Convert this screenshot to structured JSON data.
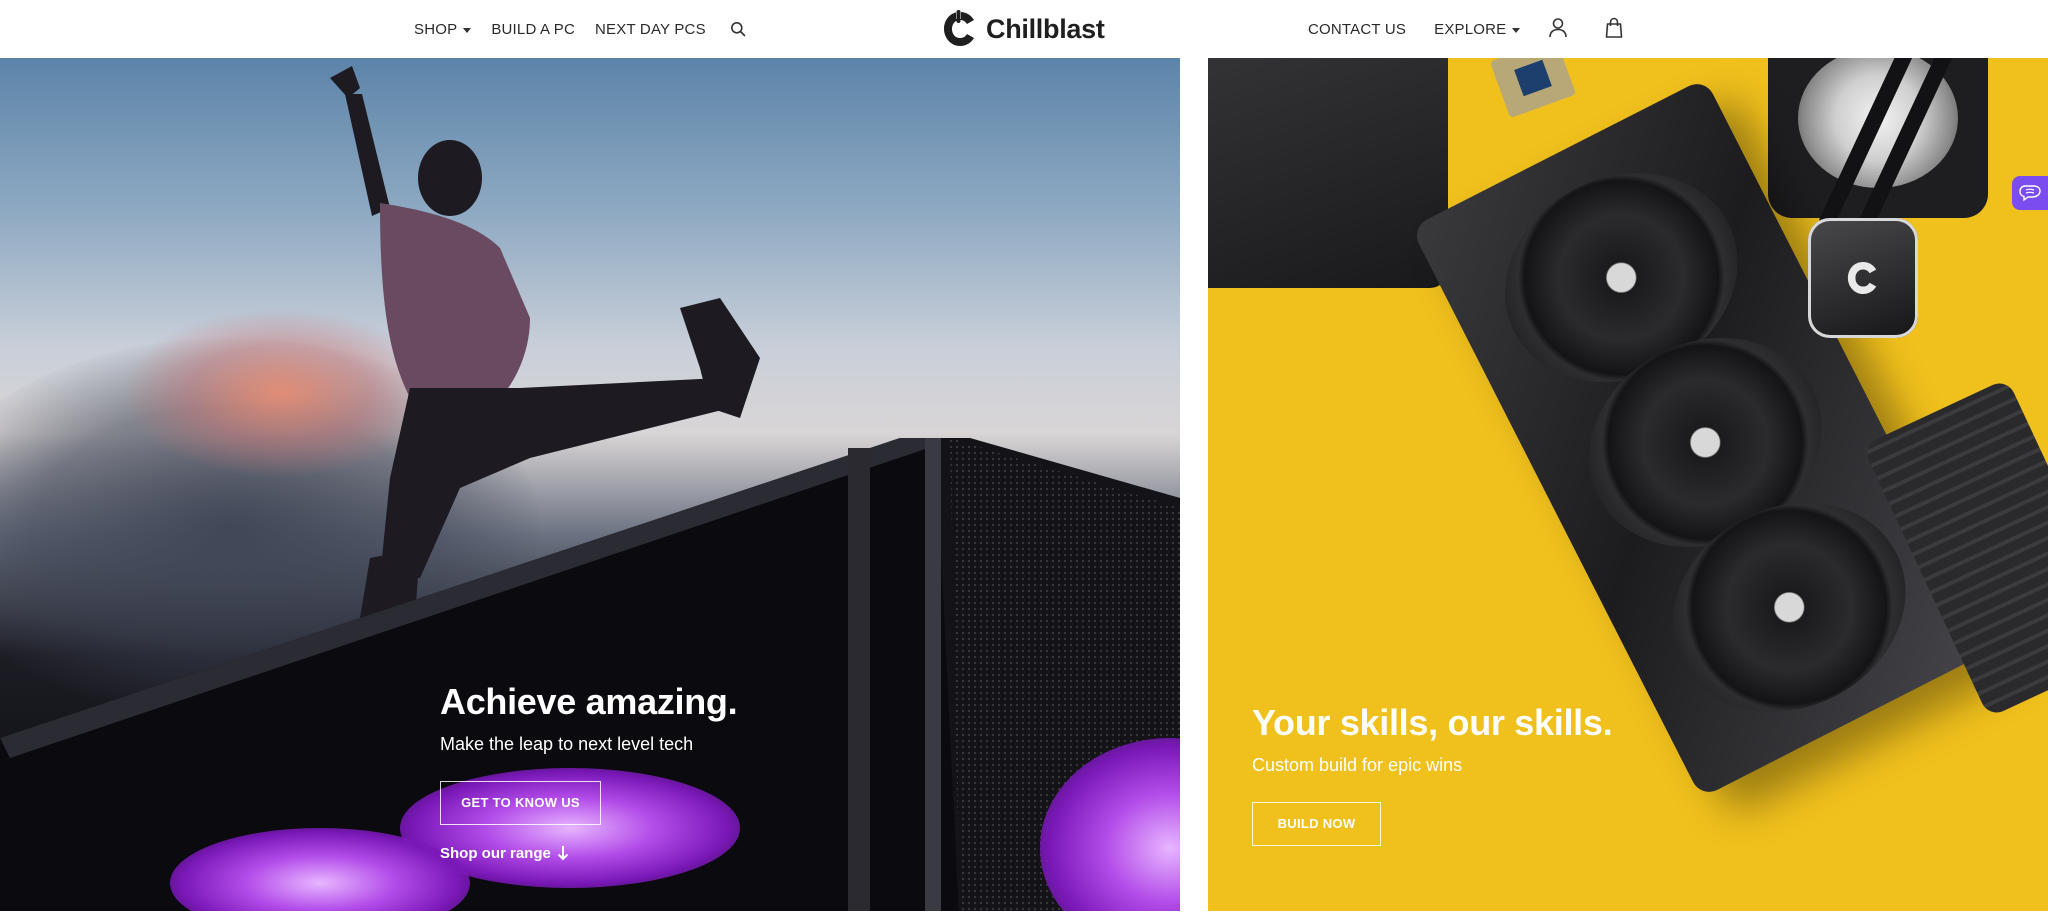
{
  "header": {
    "nav_left": [
      {
        "label": "SHOP",
        "has_dropdown": true
      },
      {
        "label": "BUILD A PC",
        "has_dropdown": false
      },
      {
        "label": "NEXT DAY PCS",
        "has_dropdown": false
      }
    ],
    "search_icon": "search-icon",
    "logo": {
      "wordmark": "Chillblast",
      "icon": "chillblast-c-icon"
    },
    "nav_right": [
      {
        "label": "CONTACT US",
        "has_dropdown": false
      },
      {
        "label": "EXPLORE",
        "has_dropdown": true
      }
    ],
    "account_icon": "user-icon",
    "basket_icon": "shopping-bag-icon"
  },
  "hero_left": {
    "headline": "Achieve amazing.",
    "subline": "Make the leap to next level tech",
    "cta_label": "GET TO KNOW US",
    "link_label": "Shop our range",
    "link_icon": "arrow-down-icon"
  },
  "hero_right": {
    "headline": "Your skills, our skills.",
    "subline": "Custom build for epic wins",
    "cta_label": "BUILD NOW"
  },
  "side_widget": {
    "icon": "accessibility-brain-icon",
    "color": "#7b4df0"
  },
  "colors": {
    "right_panel_bg": "#f0c01d",
    "text_dark": "#2a2a2a",
    "text_on_hero": "#ffffff"
  }
}
